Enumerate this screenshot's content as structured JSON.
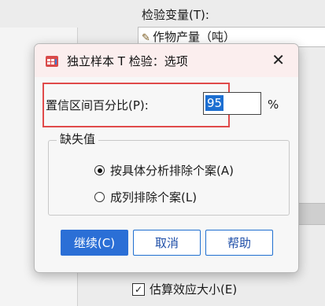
{
  "background": {
    "test_variables_label": "检验变量(T):",
    "list_item": "作物产量（吨）",
    "checkbox_label": "估算效应大小(E)"
  },
  "dialog": {
    "title": "独立样本 T 检验：选项",
    "close_glyph": "✕",
    "ci_label": "置信区间百分比(P):",
    "ci_value": "95",
    "ci_unit": "%",
    "missing_group_title": "缺失值",
    "radio_options": [
      {
        "label": "按具体分析排除个案(A)",
        "selected": true
      },
      {
        "label": "成列排除个案(L)",
        "selected": false
      }
    ],
    "buttons": {
      "continue": "继续(C)",
      "cancel": "取消",
      "help": "帮助"
    }
  },
  "colors": {
    "highlight": "#e04a4a",
    "primary": "#2b6fd6",
    "titlebar": "#fbeeee"
  }
}
